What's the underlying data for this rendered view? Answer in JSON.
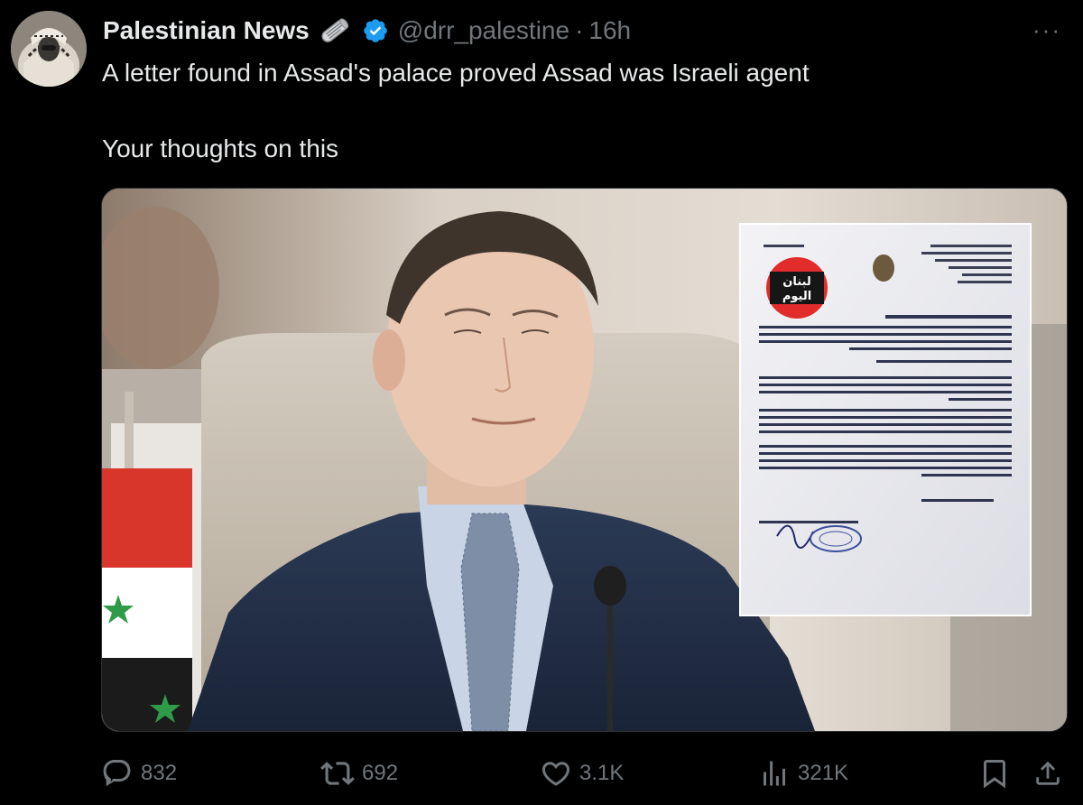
{
  "author": {
    "display_name": "Palestinian News",
    "handle": "@drr_palestine",
    "separator": "·",
    "time": "16h",
    "verified": true,
    "badge_color": "#1d9bf0"
  },
  "more_label": "···",
  "tweet": {
    "line1": "A letter found in  Assad's palace proved Assad was Israeli agent",
    "line2": "Your thoughts on this"
  },
  "media": {
    "letter_stamp_text_top": "لبنان",
    "letter_stamp_text_bottom": "اليوم"
  },
  "actions": {
    "replies": "832",
    "reposts": "692",
    "likes": "3.1K",
    "views": "321K"
  },
  "colors": {
    "background": "#000000",
    "text": "#e7e9ea",
    "muted": "#71767b",
    "accent": "#1d9bf0"
  }
}
